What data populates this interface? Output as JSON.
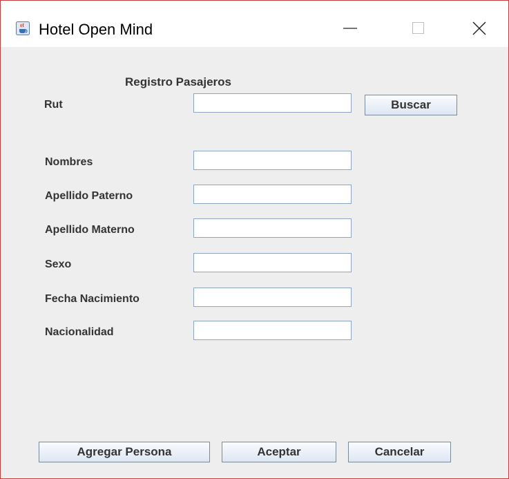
{
  "window": {
    "title": "Hotel Open Mind",
    "controls": {
      "minimize_icon": "minimize-icon",
      "maximize_icon": "maximize-icon",
      "close_icon": "close-icon"
    },
    "app_icon": "java-cup-icon"
  },
  "form": {
    "heading": "Registro Pasajeros",
    "rut": {
      "label": "Rut",
      "value": ""
    },
    "search_button": "Buscar",
    "fields": [
      {
        "label": "Nombres",
        "value": ""
      },
      {
        "label": "Apellido Paterno",
        "value": ""
      },
      {
        "label": "Apellido Materno",
        "value": ""
      },
      {
        "label": "Sexo",
        "value": ""
      },
      {
        "label": "Fecha Nacimiento",
        "value": ""
      },
      {
        "label": "Nacionalidad",
        "value": ""
      }
    ]
  },
  "actions": {
    "add_person": "Agregar Persona",
    "accept": "Aceptar",
    "cancel": "Cancelar"
  },
  "colors": {
    "window_border": "#c93a3a",
    "content_bg": "#eeeeee",
    "field_border": "#8aa5c8",
    "button_border": "#7a8a99"
  }
}
